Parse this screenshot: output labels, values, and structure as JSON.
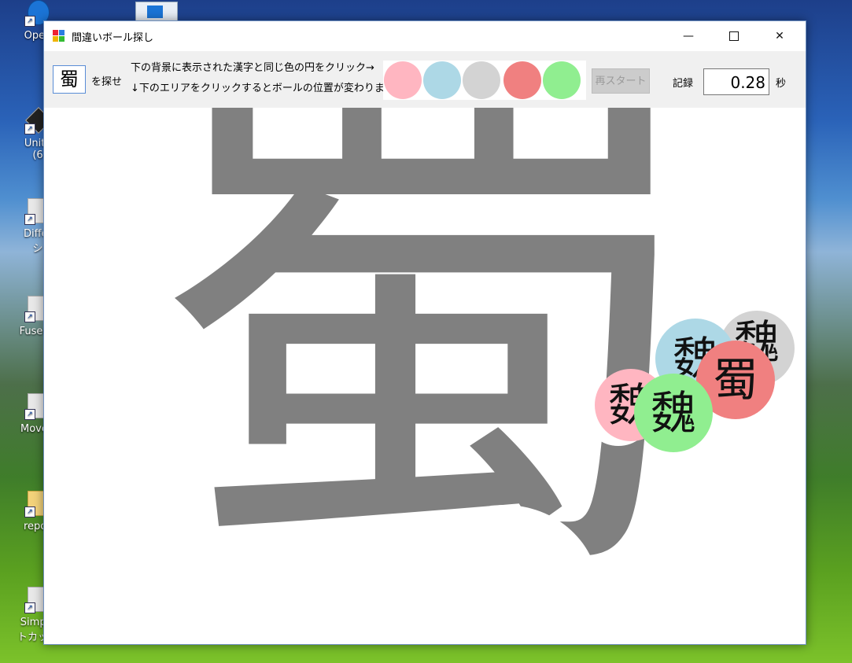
{
  "desktop": {
    "icons": [
      {
        "label": "Open"
      },
      {
        "label": "Unity"
      },
      {
        "label": "(6"
      },
      {
        "label": "Differ"
      },
      {
        "label": "シ"
      },
      {
        "label": "Fusen -"
      },
      {
        "label": "MoveC"
      },
      {
        "label": "repos"
      },
      {
        "label": "Simple"
      },
      {
        "label": "トカット"
      }
    ]
  },
  "window": {
    "title": "間違いボール探し",
    "controls": {
      "minimize": "—",
      "maximize": "",
      "close": "✕"
    }
  },
  "toolbar": {
    "target_kanji": "蜀",
    "search_label": "を探せ",
    "instruction_1": "下の背景に表示された漢字と同じ色の円をクリック→",
    "instruction_2": "↓下のエリアをクリックするとボールの位置が変わります",
    "colors": [
      "#ffb6c1",
      "#add8e6",
      "#d3d3d3",
      "#f08080",
      "#90ee90"
    ],
    "restart_label": "再スタート",
    "record_label": "記録",
    "record_value": "0.28",
    "seconds_label": "秒"
  },
  "play_area": {
    "background_kanji": "蜀",
    "background_color": "#808080",
    "balls": [
      {
        "kanji": "魏",
        "color": "#d3d3d3"
      },
      {
        "kanji": "魏",
        "color": "#add8e6"
      },
      {
        "kanji": "魏",
        "color": "#ffb6c1"
      },
      {
        "kanji": "蜀",
        "color": "#f08080"
      },
      {
        "kanji": "魏",
        "color": "#90ee90"
      }
    ]
  }
}
